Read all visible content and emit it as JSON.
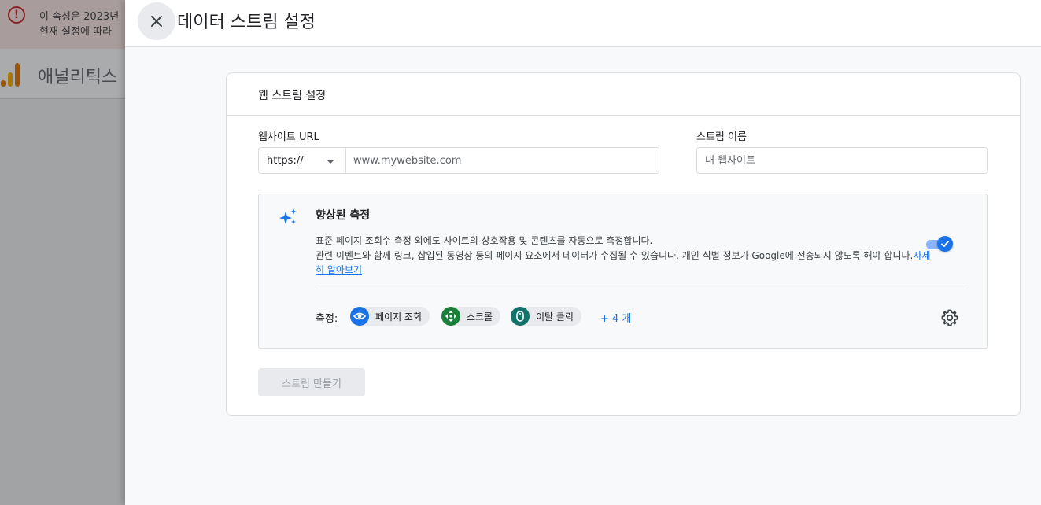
{
  "background": {
    "banner": {
      "line1": "이 속성은 2023년",
      "line2": "현재 설정에 따라"
    },
    "app_title": "애널리틱스"
  },
  "sheet": {
    "title": "데이터 스트림 설정"
  },
  "card": {
    "title": "웹 스트림 설정",
    "website_url": {
      "label": "웹사이트 URL",
      "protocol": "https://",
      "placeholder": "www.mywebsite.com"
    },
    "stream_name": {
      "label": "스트림 이름",
      "placeholder": "내 웹사이트"
    },
    "enhanced_measurement": {
      "title": "향상된 측정",
      "description_line1": "표준 페이지 조회수 측정 외에도 사이트의 상호작용 및 콘텐츠를 자동으로 측정합니다.",
      "description_line2": "관련 이벤트와 함께 링크, 삽입된 동영상 등의 페이지 요소에서 데이터가 수집될 수 있습니다. 개인 식별 정보가 Google에 전송되지 않도록 해야 합니다.",
      "learn_more": "자세히 알아보기",
      "enabled": true,
      "measuring_label": "측정:",
      "chips": [
        {
          "label": "페이지 조회",
          "icon": "eye-icon"
        },
        {
          "label": "스크롤",
          "icon": "scroll-icon"
        },
        {
          "label": "이탈 클릭",
          "icon": "mouse-icon"
        }
      ],
      "more_label": "+ 4 개"
    },
    "create_button": "스트림 만들기"
  },
  "colors": {
    "accent": "#1a73e8",
    "scroll_chip": "#188038",
    "outbound_chip": "#12736b"
  }
}
